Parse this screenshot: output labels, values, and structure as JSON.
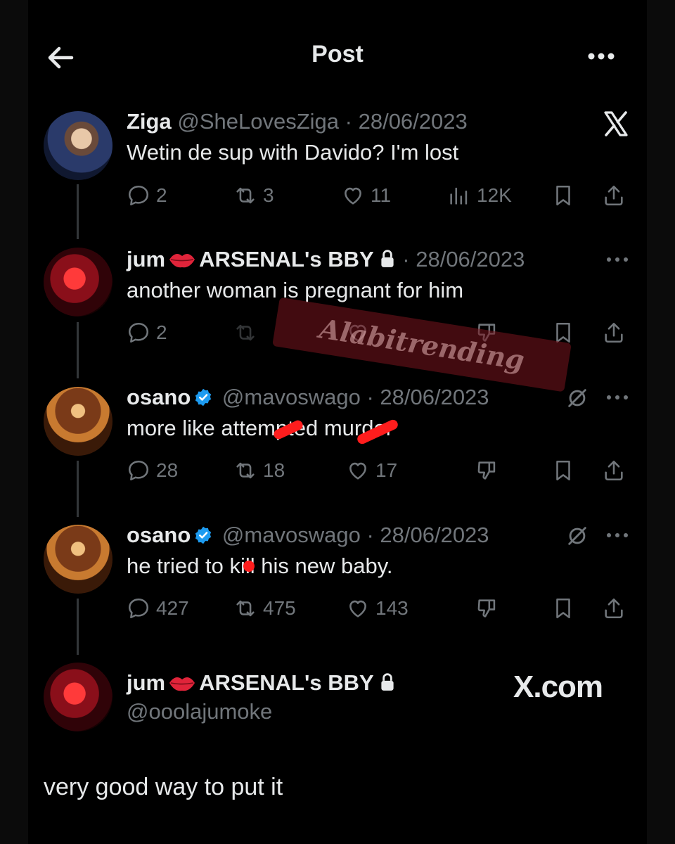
{
  "header": {
    "title": "Post",
    "back_icon": "arrow-left-icon",
    "more_icon": "more-horizontal-icon"
  },
  "watermark": "Alabitrending",
  "brand_badge": "X.com",
  "tweets": [
    {
      "name": "Ziga",
      "handle": "@SheLovesZiga",
      "separator": "·",
      "date": "28/06/2023",
      "text": "Wetin de sup with Davido? I'm lost",
      "replies": "2",
      "reposts": "3",
      "likes": "11",
      "views": "12K"
    },
    {
      "name_prefix": "jum",
      "name_suffix": "ARSENAL's BBY",
      "separator": "·",
      "date": "28/06/2023",
      "text": "another woman is pregnant for him",
      "replies": "2"
    },
    {
      "name": "osano",
      "handle": "@mavoswago",
      "separator": "·",
      "date": "28/06/2023",
      "text": "more like attempted murder",
      "replies": "28",
      "reposts": "18",
      "likes": "17"
    },
    {
      "name": "osano",
      "handle": "@mavoswago",
      "separator": "·",
      "date": "28/06/2023",
      "text": "he tried to kill his new baby.",
      "replies": "427",
      "reposts": "475",
      "likes": "143"
    }
  ],
  "reply_author": {
    "name_prefix": "jum",
    "name_suffix": "ARSENAL's BBY",
    "handle": "@ooolajumoke"
  },
  "reply_text": "very good way to put it",
  "colors": {
    "background": "#000000",
    "text_primary": "#e7e9ea",
    "text_secondary": "#71767b",
    "verified": "#1d9bf0",
    "redaction": "#ff1d1d"
  }
}
